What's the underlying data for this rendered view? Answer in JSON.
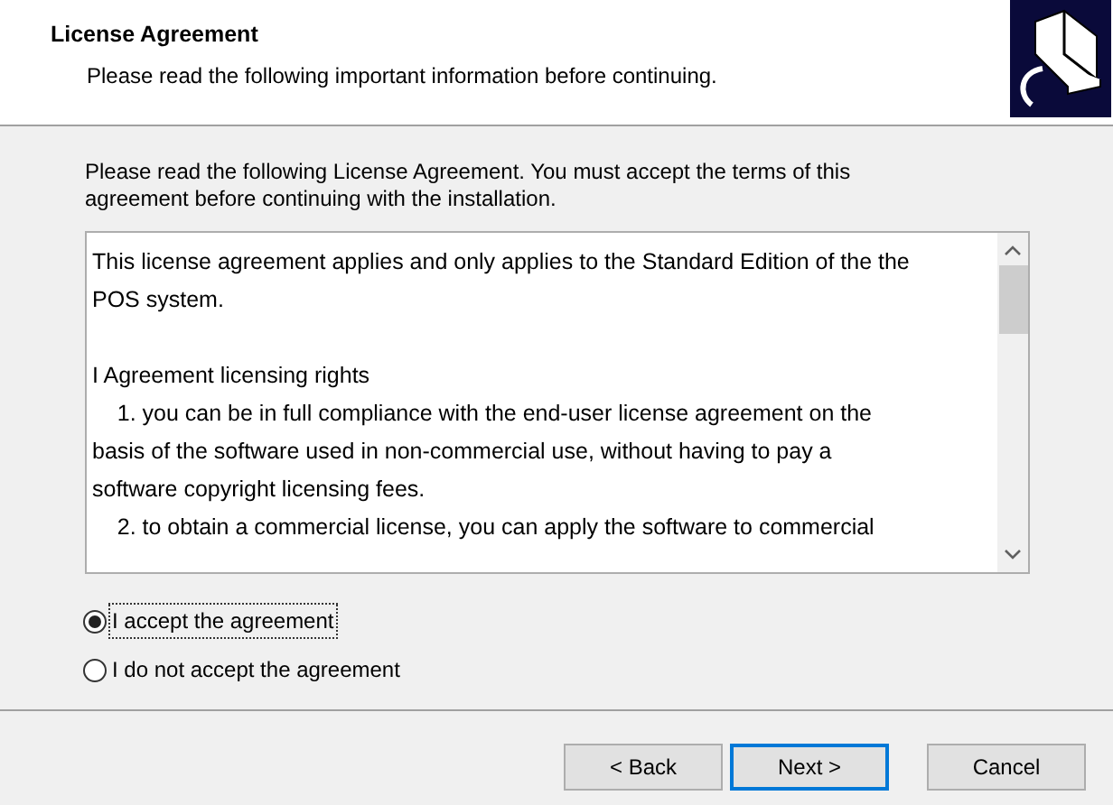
{
  "header": {
    "title": "License Agreement",
    "subtitle": "Please read the following important information before continuing."
  },
  "intro": [
    "Please read the following License Agreement. You must accept the terms of this",
    "agreement before continuing with the installation."
  ],
  "license_text": [
    [
      "This license agreement applies and only applies to the Standard Edition of the the",
      "POS system."
    ],
    [
      "I Agreement licensing rights",
      "    1. you can be in full compliance with the end-user license agreement on the",
      "basis of the software used in non-commercial use, without having to pay a",
      "software copyright licensing fees.",
      "    2. to obtain a commercial license, you can apply the software to commercial"
    ]
  ],
  "options": [
    {
      "label": "I accept the agreement",
      "selected": true
    },
    {
      "label": "I do not accept the agreement",
      "selected": false
    }
  ],
  "buttons": [
    {
      "label": "< Back",
      "default": false
    },
    {
      "label": "Next >",
      "default": true
    },
    {
      "label": "Cancel",
      "default": false
    }
  ]
}
